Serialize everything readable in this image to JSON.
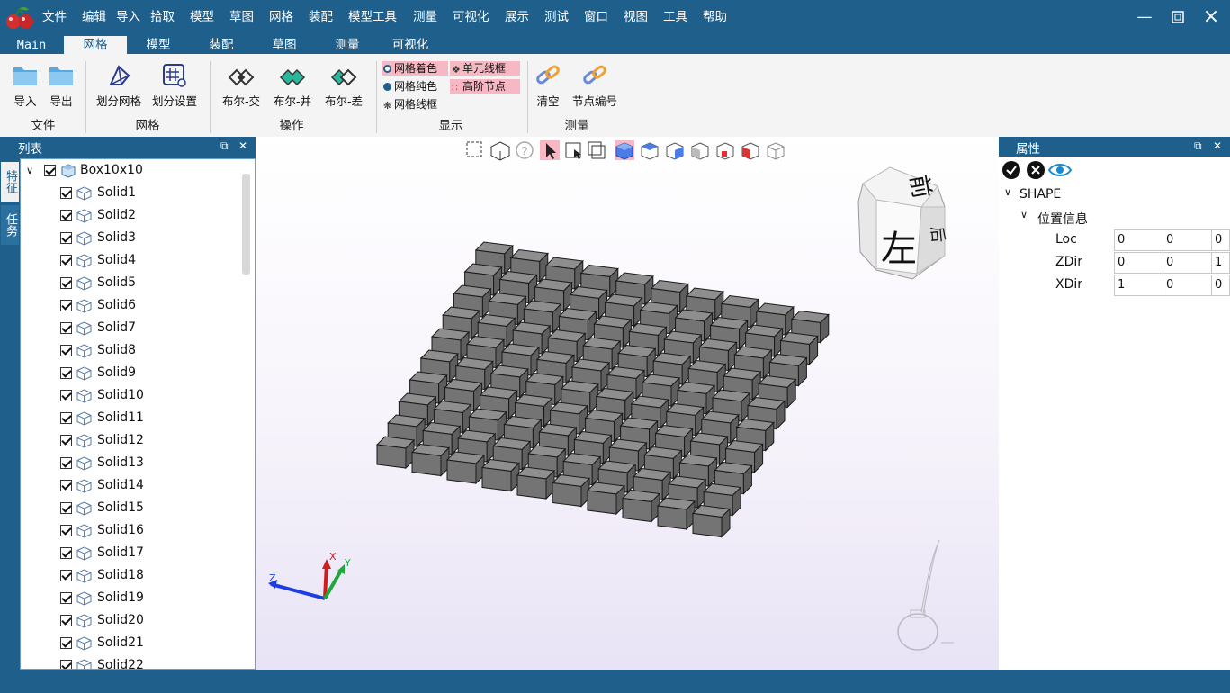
{
  "menu": [
    "文件",
    "编辑",
    "导入",
    "拾取",
    "模型",
    "草图",
    "网格",
    "装配",
    "模型工具",
    "测量",
    "可视化",
    "展示",
    "测试",
    "窗口",
    "视图",
    "工具",
    "帮助"
  ],
  "ribbon_tabs": [
    "Main",
    "网格",
    "模型",
    "装配",
    "草图",
    "测量",
    "可视化"
  ],
  "active_tab": "网格",
  "ribbon": {
    "file": {
      "label": "文件",
      "import": "导入",
      "export": "导出"
    },
    "mesh": {
      "label": "网格",
      "partition": "划分网格",
      "settings": "划分设置"
    },
    "ops": {
      "label": "操作",
      "intersect": "布尔-交",
      "union": "布尔-并",
      "diff": "布尔-差"
    },
    "display": {
      "label": "显示",
      "mesh_color": "网格着色",
      "unit_wire": "单元线框",
      "mesh_solid": "网格纯色",
      "high_order": "高阶节点",
      "mesh_wire": "网格线框"
    },
    "measure": {
      "label": "测量",
      "clear": "清空",
      "node_number": "节点编号"
    }
  },
  "left_panel": {
    "title": "列表",
    "vtabs": [
      "特征",
      "任务"
    ],
    "root": "Box10x10",
    "items": [
      "Solid1",
      "Solid2",
      "Solid3",
      "Solid4",
      "Solid5",
      "Solid6",
      "Solid7",
      "Solid8",
      "Solid9",
      "Solid10",
      "Solid11",
      "Solid12",
      "Solid13",
      "Solid14",
      "Solid15",
      "Solid16",
      "Solid17",
      "Solid18",
      "Solid19",
      "Solid20",
      "Solid21",
      "Solid22"
    ]
  },
  "viewcube": {
    "front": "左",
    "top": "前",
    "side": "后"
  },
  "axes": {
    "x": "X",
    "y": "Y",
    "z": "Z"
  },
  "right_panel": {
    "title": "属性",
    "shape": "SHAPE",
    "group": "位置信息",
    "rows": [
      {
        "name": "Loc",
        "v": [
          "0",
          "0",
          "0"
        ]
      },
      {
        "name": "ZDir",
        "v": [
          "0",
          "0",
          "1"
        ]
      },
      {
        "name": "XDir",
        "v": [
          "1",
          "0",
          "0"
        ]
      }
    ]
  },
  "colors": {
    "accent": "#1f5f8b",
    "highlight": "#f7b8c4",
    "cube": "#7a7a7a"
  }
}
